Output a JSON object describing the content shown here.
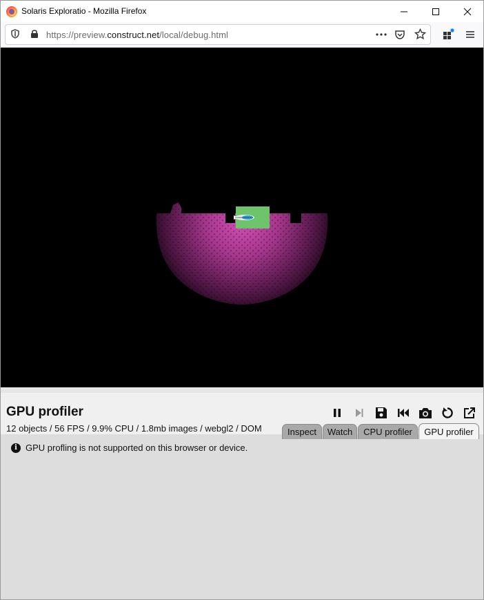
{
  "window": {
    "title": "Solaris Exploratio - Mozilla Firefox"
  },
  "navbar": {
    "url_prefix": "https://preview.",
    "url_host": "construct.net",
    "url_path": "/local/debug.html"
  },
  "debugger": {
    "title": "GPU profiler",
    "stats": "12 objects / 56 FPS / 9.9% CPU / 1.8mb images / webgl2 / DOM",
    "tabs": [
      "Inspect",
      "Watch",
      "CPU profiler",
      "GPU profiler"
    ],
    "active_tab": "GPU profiler",
    "notice_icon": "info-icon",
    "notice": "GPU profling is not supported on this browser or device."
  },
  "colors": {
    "game_bg": "#000000",
    "platform_glow": "#c040a0",
    "player_box": "#6ec46a",
    "panel_bg": "#dddddd",
    "tab_inactive": "#a9a9a9",
    "tab_active": "#f4f4f4"
  }
}
